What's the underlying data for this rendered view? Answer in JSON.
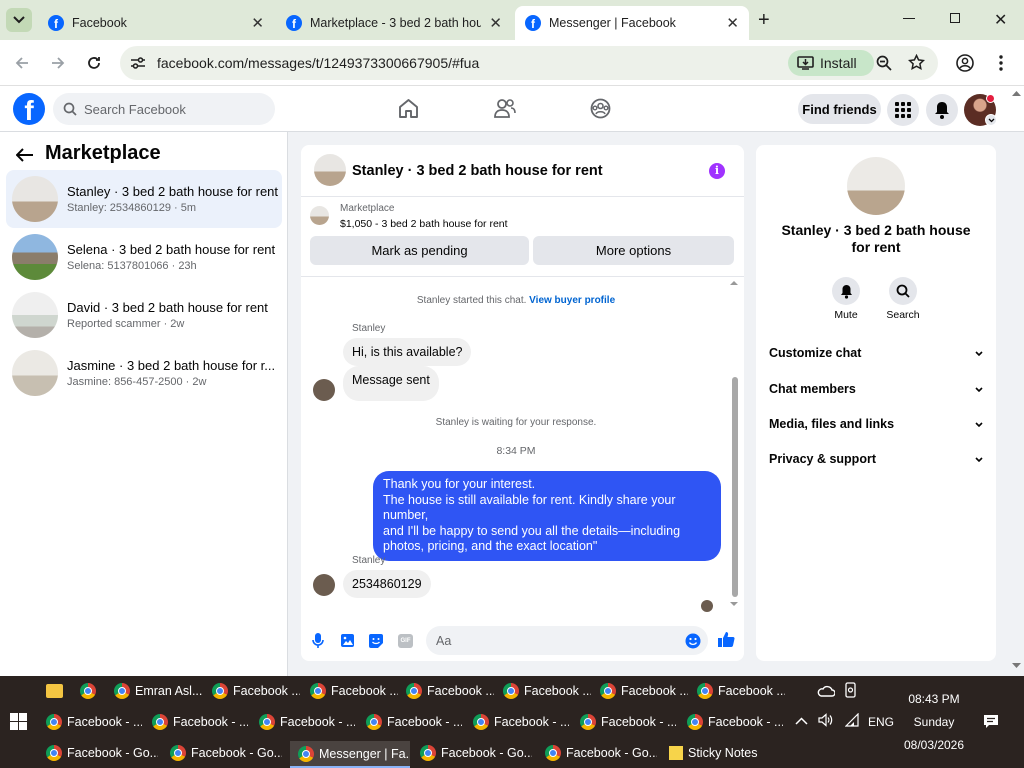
{
  "browser": {
    "tabs": [
      {
        "title": "Facebook"
      },
      {
        "title": "Marketplace - 3 bed 2 bath hou"
      },
      {
        "title": "Messenger | Facebook"
      }
    ],
    "url": "facebook.com/messages/t/1249373300667905/#fua",
    "install_label": "Install"
  },
  "fb": {
    "logo": "f",
    "search_placeholder": "Search Facebook",
    "find_friends": "Find friends"
  },
  "left": {
    "title": "Marketplace",
    "conversations": [
      {
        "title": "Stanley · 3 bed 2 bath house for rent",
        "sub": "Stanley: 2534860129 · 5m"
      },
      {
        "title": "Selena · 3 bed 2 bath house for rent",
        "sub": "Selena: 5137801066 · 23h"
      },
      {
        "title": "David · 3 bed 2 bath house for rent",
        "sub": "Reported scammer · 2w"
      },
      {
        "title": "Jasmine · 3 bed 2 bath house for r...",
        "sub": "Jasmine: 856-457-2500 · 2w"
      }
    ]
  },
  "chat": {
    "title": "Stanley · 3 bed 2 bath house for rent",
    "marketplace_label": "Marketplace",
    "listing": "$1,050 - 3 bed 2 bath house for rent",
    "mark_pending": "Mark as pending",
    "more_options": "More options",
    "started": "Stanley started this chat.",
    "view_profile": "View buyer profile",
    "sender1": "Stanley",
    "msg1": "Hi, is this available?",
    "msg2": "Message sent",
    "waiting": "Stanley is waiting for your response.",
    "time": "8:34 PM",
    "reply_lines": [
      "Thank you for your interest.",
      "The house is still available for rent. Kindly share your number,",
      "and I'll be happy to send you all the details—including",
      "photos, pricing, and the exact location\""
    ],
    "sender2": "Stanley",
    "msg3": "2534860129",
    "composer_placeholder": "Aa"
  },
  "right": {
    "title": "Stanley · 3 bed 2 bath house for rent",
    "mute": "Mute",
    "search": "Search",
    "rows": [
      "Customize chat",
      "Chat members",
      "Media, files and links",
      "Privacy & support"
    ]
  },
  "taskbar": {
    "row1": [
      "Emran Asl...",
      "Facebook ...",
      "Facebook ...",
      "Facebook ...",
      "Facebook ...",
      "Facebook ...",
      "Facebook ..."
    ],
    "row2": [
      "Facebook - ...",
      "Facebook - ...",
      "Facebook - ...",
      "Facebook - ...",
      "Facebook - ...",
      "Facebook - ...",
      "Facebook - ..."
    ],
    "row3": [
      "Facebook - Go...",
      "Facebook - Go...",
      "Messenger | Fa...",
      "Facebook - Go...",
      "Facebook - Go...",
      "Sticky Notes"
    ],
    "lang": "ENG",
    "time": "08:43 PM",
    "day": "Sunday",
    "date": "08/03/2026"
  },
  "colors": {
    "fb_blue": "#0866ff",
    "bubble_blue": "#2f55f4",
    "info_purple": "#a033ff"
  }
}
